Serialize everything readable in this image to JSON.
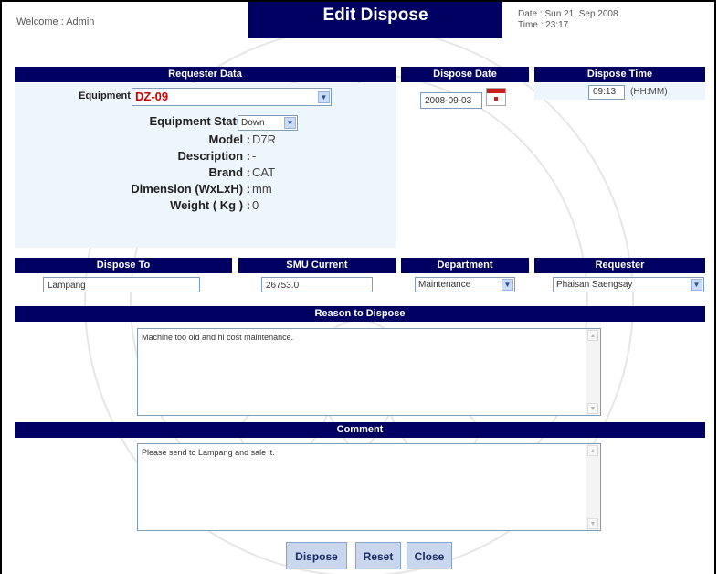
{
  "header": {
    "welcome": "Welcome : Admin",
    "title": "Edit Dispose",
    "date": "Date : Sun 21, Sep 2008",
    "time": "Time : 23:17"
  },
  "sections": {
    "requester_data": "Requester Data",
    "dispose_date": "Dispose Date",
    "dispose_time": "Dispose Time",
    "dispose_to": "Dispose To",
    "smu_current": "SMU Current",
    "department": "Department",
    "requester": "Requester",
    "reason": "Reason to Dispose",
    "comment": "Comment"
  },
  "equipment": {
    "id_label": "Equipment ID",
    "id_value": "DZ-09",
    "status_label": "Equipment Status",
    "status_value": "Down",
    "model_label": "Model :",
    "model_value": "D7R",
    "description_label": "Description :",
    "description_value": "-",
    "brand_label": "Brand :",
    "brand_value": "CAT",
    "dimension_label": "Dimension (WxLxH) :",
    "dimension_value": "mm",
    "weight_label": "Weight ( Kg ) :",
    "weight_value": "0"
  },
  "dispose": {
    "date_value": "2008-09-03",
    "time_value": "09:13",
    "time_hint": "(HH:MM)",
    "to_value": "Lampang",
    "smu_value": "26753.0",
    "department_value": "Maintenance",
    "requester_value": "Phaisan Saengsay",
    "reason_text": "Machine too old and hi cost maintenance.",
    "comment_text": "Please send to Lampang and sale it."
  },
  "buttons": {
    "dispose": "Dispose",
    "reset": "Reset",
    "close": "Close"
  },
  "colors": {
    "header_bar": "#000062",
    "panel_bg": "#eef6fd",
    "equipment_id": "#cc0000"
  }
}
